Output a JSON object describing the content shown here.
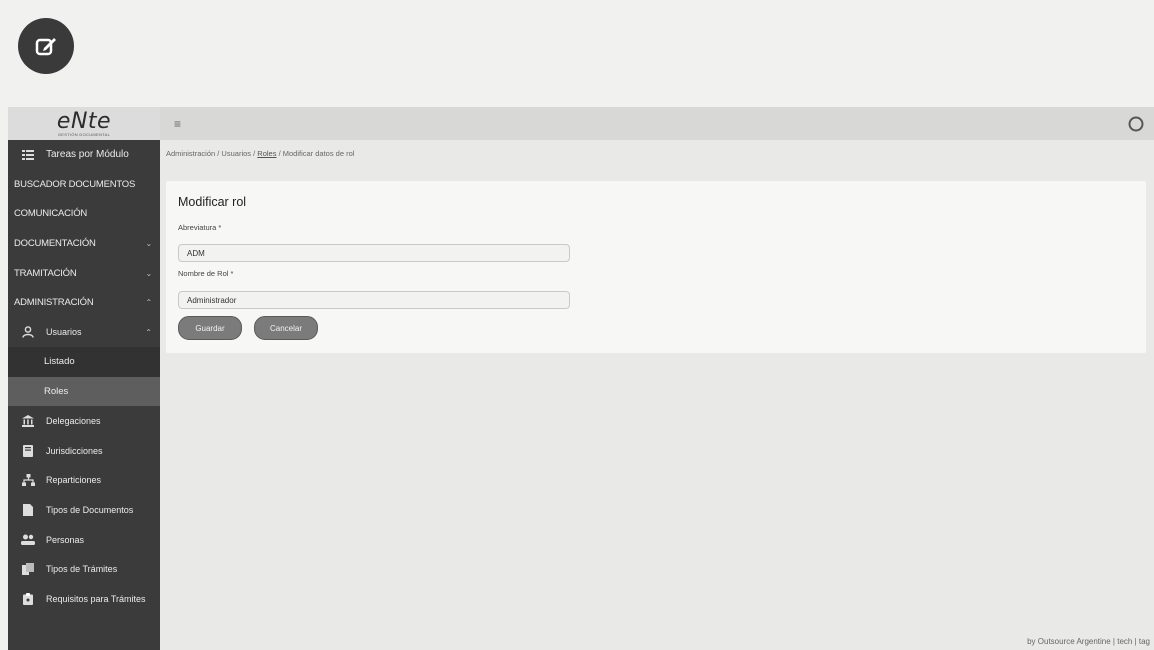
{
  "brand": {
    "name": "eNte",
    "tagline": "GESTIÓN DOCUMENTAL"
  },
  "sidebar": {
    "items": [
      {
        "label": "Tareas por Módulo",
        "icon": "list-icon"
      },
      {
        "label": "BUSCADOR DOCUMENTOS"
      },
      {
        "label": "COMUNICACIÓN"
      },
      {
        "label": "DOCUMENTACIÓN",
        "chevron": "chevron-down-icon"
      },
      {
        "label": "TRAMITACIÓN",
        "chevron": "chevron-down-icon"
      },
      {
        "label": "ADMINISTRACIÓN",
        "chevron": "chevron-up-icon"
      },
      {
        "label": "Usuarios",
        "icon": "user-icon",
        "chevron": "chevron-up-icon"
      },
      {
        "label": "Listado"
      },
      {
        "label": "Roles"
      },
      {
        "label": "Delegaciones",
        "icon": "bank-icon"
      },
      {
        "label": "Jurisdicciones",
        "icon": "book-icon"
      },
      {
        "label": "Reparticiones",
        "icon": "sitemap-icon"
      },
      {
        "label": "Tipos de Documentos",
        "icon": "file-icon"
      },
      {
        "label": "Personas",
        "icon": "users-icon"
      },
      {
        "label": "Tipos de Trámites",
        "icon": "files-icon"
      },
      {
        "label": "Requisitos para Trámites",
        "icon": "clipboard-icon"
      }
    ]
  },
  "topbar": {
    "menu_icon": "hamburger-icon",
    "user_icon": "user-circle-icon"
  },
  "breadcrumb": {
    "part1": "Administración / Usuarios / ",
    "link": "Roles",
    "part2": " / Modificar datos de rol"
  },
  "form": {
    "title": "Modificar rol",
    "abbr_label": "Abreviatura *",
    "abbr_value": "ADM",
    "name_label": "Nombre de Rol *",
    "name_value": "Administrador",
    "save_label": "Guardar",
    "cancel_label": "Cancelar"
  },
  "footer": {
    "text": "by Outsource Argentine | tech | tag"
  },
  "colors": {
    "sidebar": "#3b3b3b",
    "active": "#5e5e5e",
    "button": "#7b7b7b"
  }
}
